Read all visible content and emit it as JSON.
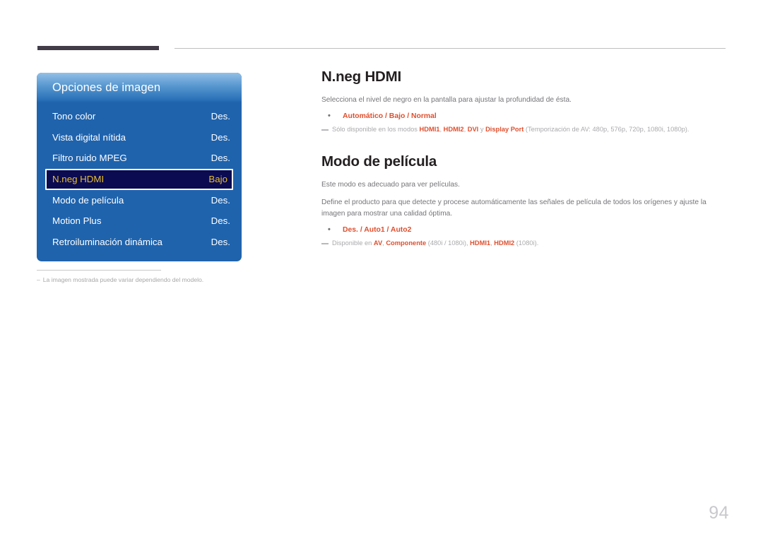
{
  "page": {
    "number": "94"
  },
  "osd_menu": {
    "title": "Opciones de imagen",
    "rows": [
      {
        "label": "Tono color",
        "value": "Des.",
        "selected": false
      },
      {
        "label": "Vista digital nítida",
        "value": "Des.",
        "selected": false
      },
      {
        "label": "Filtro ruido MPEG",
        "value": "Des.",
        "selected": false
      },
      {
        "label": "N.neg HDMI",
        "value": "Bajo",
        "selected": true
      },
      {
        "label": "Modo de película",
        "value": "Des.",
        "selected": false
      },
      {
        "label": "Motion Plus",
        "value": "Des.",
        "selected": false
      },
      {
        "label": "Retroiluminación dinámica",
        "value": "Des.",
        "selected": false
      }
    ],
    "note": "La imagen mostrada puede variar dependiendo del modelo.",
    "note_dash": "–"
  },
  "sections": [
    {
      "title": "N.neg HDMI",
      "paragraphs": [
        "Selecciona el nivel de negro en la pantalla para ajustar la profundidad de ésta."
      ],
      "options": "Automático / Bajo / Normal",
      "footnote_parts": [
        {
          "text": "Sólo disponible en los modos ",
          "bold": false
        },
        {
          "text": "HDMI1",
          "bold": true
        },
        {
          "text": ", ",
          "bold": false
        },
        {
          "text": "HDMI2",
          "bold": true
        },
        {
          "text": ", ",
          "bold": false
        },
        {
          "text": "DVI",
          "bold": true
        },
        {
          "text": " y ",
          "bold": false
        },
        {
          "text": "Display Port",
          "bold": true
        },
        {
          "text": " (Temporización de AV: 480p, 576p, 720p, 1080i, 1080p).",
          "bold": false
        }
      ]
    },
    {
      "title": "Modo de película",
      "paragraphs": [
        "Este modo es adecuado para ver películas.",
        "Define el producto para que detecte y procese automáticamente las señales de película de todos los orígenes y ajuste la imagen para mostrar una calidad óptima."
      ],
      "options": "Des. / Auto1 / Auto2",
      "footnote_parts": [
        {
          "text": "Disponible en ",
          "bold": false
        },
        {
          "text": "AV",
          "bold": true
        },
        {
          "text": ", ",
          "bold": false
        },
        {
          "text": "Componente",
          "bold": true
        },
        {
          "text": " (480i / 1080i), ",
          "bold": false
        },
        {
          "text": "HDMI1",
          "bold": true
        },
        {
          "text": ", ",
          "bold": false
        },
        {
          "text": "HDMI2",
          "bold": true
        },
        {
          "text": " (1080i).",
          "bold": false
        }
      ]
    }
  ],
  "colors": {
    "osd_blue": "#1f63ad",
    "osd_selected_bg": "#0b0b52",
    "osd_selected_text": "#e9bf2e",
    "accent_orange": "#df4f2e",
    "body_gray": "#75757a",
    "footnote_gray": "#aaaaae",
    "header_bar": "#413c48"
  }
}
